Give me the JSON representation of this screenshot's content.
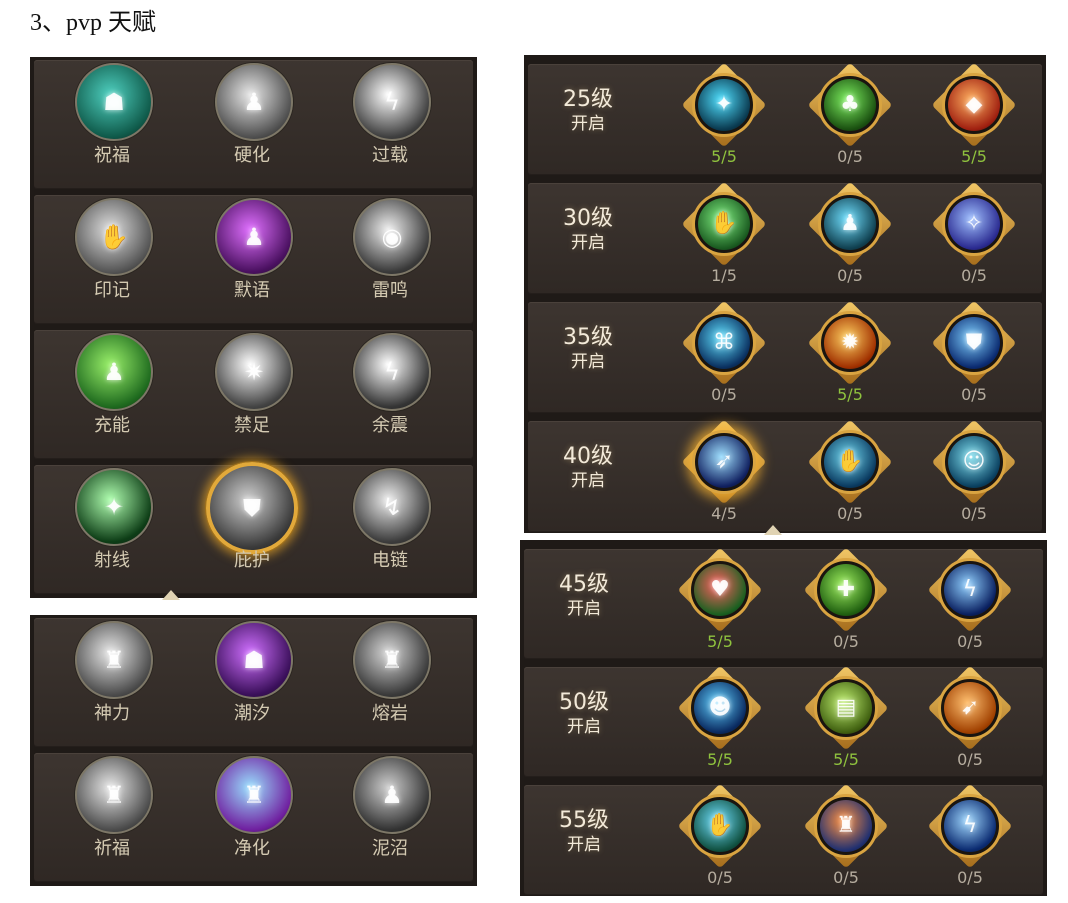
{
  "heading": "3、pvp 天赋",
  "left_panel_top": {
    "rows": [
      [
        {
          "label": "祝福",
          "glyph": "☗",
          "colors": [
            "#4fd0c0",
            "#0f5a4a"
          ]
        },
        {
          "label": "硬化",
          "glyph": "♟",
          "colors": [
            "#e8e8e8",
            "#505050"
          ]
        },
        {
          "label": "过载",
          "glyph": "ϟ",
          "colors": [
            "#ffffff",
            "#404040"
          ]
        }
      ],
      [
        {
          "label": "印记",
          "glyph": "✋",
          "colors": [
            "#e0e0e0",
            "#555555"
          ]
        },
        {
          "label": "默语",
          "glyph": "♟",
          "colors": [
            "#e070ff",
            "#4a1060"
          ]
        },
        {
          "label": "雷鸣",
          "glyph": "◉",
          "colors": [
            "#f0f0f0",
            "#3a3a3a"
          ]
        }
      ],
      [
        {
          "label": "充能",
          "glyph": "♟",
          "colors": [
            "#9af06a",
            "#1e6a1e"
          ]
        },
        {
          "label": "禁足",
          "glyph": "✷",
          "colors": [
            "#ffffff",
            "#444444"
          ]
        },
        {
          "label": "余震",
          "glyph": "ϟ",
          "colors": [
            "#ffffff",
            "#353535"
          ]
        }
      ],
      [
        {
          "label": "射线",
          "glyph": "✦",
          "colors": [
            "#b0ffb0",
            "#0d3d16"
          ]
        },
        {
          "label": "庇护",
          "glyph": "⛊",
          "colors": [
            "#cfcfcf",
            "#3a3a3a"
          ],
          "selected": true
        },
        {
          "label": "电链",
          "glyph": "↯",
          "colors": [
            "#eeeeee",
            "#3c3c3c"
          ]
        }
      ]
    ]
  },
  "left_panel_bottom": {
    "rows": [
      [
        {
          "label": "神力",
          "glyph": "♜",
          "colors": [
            "#e8e8e8",
            "#4c4c4c"
          ]
        },
        {
          "label": "潮汐",
          "glyph": "☗",
          "colors": [
            "#d070ff",
            "#3a0f5a"
          ]
        },
        {
          "label": "熔岩",
          "glyph": "♜",
          "colors": [
            "#d8d8d8",
            "#3a3a3a"
          ]
        }
      ],
      [
        {
          "label": "祈福",
          "glyph": "♜",
          "colors": [
            "#e8e8e8",
            "#4c4c4c"
          ]
        },
        {
          "label": "净化",
          "glyph": "♜",
          "colors": [
            "#9ae0ff",
            "#7020a0"
          ]
        },
        {
          "label": "泥沼",
          "glyph": "♟",
          "colors": [
            "#cfcfcf",
            "#333333"
          ]
        }
      ]
    ]
  },
  "right_panel_top": {
    "rows": [
      {
        "level": "25级",
        "open": "开启",
        "talents": [
          {
            "count": "5/5",
            "full": true,
            "glyph": "✦",
            "colors": [
              "#50e0ff",
              "#0a3a50"
            ]
          },
          {
            "count": "0/5",
            "full": false,
            "glyph": "♣",
            "colors": [
              "#7ef060",
              "#1a5010"
            ]
          },
          {
            "count": "5/5",
            "full": true,
            "glyph": "◆",
            "colors": [
              "#ffb060",
              "#a02010"
            ]
          }
        ]
      },
      {
        "level": "30级",
        "open": "开启",
        "talents": [
          {
            "count": "1/5",
            "full": false,
            "glyph": "✋",
            "colors": [
              "#80f080",
              "#1a5a20"
            ]
          },
          {
            "count": "0/5",
            "full": false,
            "glyph": "♟",
            "colors": [
              "#70e0ff",
              "#104050"
            ]
          },
          {
            "count": "0/5",
            "full": false,
            "glyph": "✧",
            "colors": [
              "#a0c0ff",
              "#2a2a90"
            ]
          }
        ]
      },
      {
        "level": "35级",
        "open": "开启",
        "talents": [
          {
            "count": "0/5",
            "full": false,
            "glyph": "⌘",
            "colors": [
              "#60e0ff",
              "#0a3060"
            ]
          },
          {
            "count": "5/5",
            "full": true,
            "glyph": "✹",
            "colors": [
              "#ffd060",
              "#a03000"
            ]
          },
          {
            "count": "0/5",
            "full": false,
            "glyph": "⛊",
            "colors": [
              "#80d0ff",
              "#0a2a70"
            ]
          }
        ]
      },
      {
        "level": "40级",
        "open": "开启",
        "talents": [
          {
            "count": "4/5",
            "full": false,
            "glyph": "➶",
            "colors": [
              "#a0e0ff",
              "#102060"
            ],
            "glow": true
          },
          {
            "count": "0/5",
            "full": false,
            "glyph": "✋",
            "colors": [
              "#70d8f0",
              "#0a3a60"
            ]
          },
          {
            "count": "0/5",
            "full": false,
            "glyph": "☺",
            "colors": [
              "#80e0f0",
              "#0a4060"
            ]
          }
        ]
      }
    ]
  },
  "right_panel_bottom": {
    "rows": [
      {
        "level": "45级",
        "open": "开启",
        "talents": [
          {
            "count": "5/5",
            "full": true,
            "glyph": "♥",
            "colors": [
              "#ff6060",
              "#1a6020"
            ]
          },
          {
            "count": "0/5",
            "full": false,
            "glyph": "✚",
            "colors": [
              "#a0f060",
              "#206010"
            ]
          },
          {
            "count": "0/5",
            "full": false,
            "glyph": "ϟ",
            "colors": [
              "#90d0ff",
              "#0a2060"
            ]
          }
        ]
      },
      {
        "level": "50级",
        "open": "开启",
        "talents": [
          {
            "count": "5/5",
            "full": true,
            "glyph": "☻",
            "colors": [
              "#60d0ff",
              "#0a2a60"
            ]
          },
          {
            "count": "5/5",
            "full": true,
            "glyph": "▤",
            "colors": [
              "#c0f070",
              "#406010"
            ]
          },
          {
            "count": "0/5",
            "full": false,
            "glyph": "➹",
            "colors": [
              "#ffc070",
              "#a04000"
            ]
          }
        ]
      },
      {
        "level": "55级",
        "open": "开启",
        "talents": [
          {
            "count": "0/5",
            "full": false,
            "glyph": "✋",
            "colors": [
              "#70e0ff",
              "#105040"
            ]
          },
          {
            "count": "0/5",
            "full": false,
            "glyph": "♜",
            "colors": [
              "#ff9040",
              "#203070"
            ]
          },
          {
            "count": "0/5",
            "full": false,
            "glyph": "ϟ",
            "colors": [
              "#a0d8ff",
              "#0a2a70"
            ]
          }
        ]
      }
    ]
  }
}
